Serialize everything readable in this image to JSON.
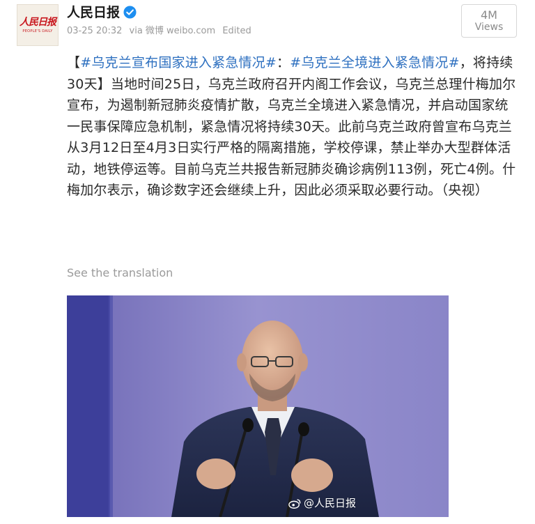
{
  "author": {
    "name": "人民日报",
    "avatar_logo": "人民日报",
    "avatar_logo_sub": "PEOPLE'S DAILY",
    "verified_icon": "verified-badge-icon"
  },
  "meta": {
    "timestamp": "03-25 20:32",
    "via": "via 微博 weibo.com",
    "edited": "Edited"
  },
  "views": {
    "count": "4M",
    "label": "Views"
  },
  "post": {
    "bracket_open": "【",
    "hashtag1": "#乌克兰宣布国家进入紧急情况#",
    "colon": "：",
    "hashtag2": "#乌克兰全境进入紧急情况#",
    "lead": "，将持续30天】",
    "body": "当地时间25日，乌克兰政府召开内阁工作会议，乌克兰总理什梅加尔宣布，为遏制新冠肺炎疫情扩散，乌克兰全境进入紧急情况，并启动国家统一民事保障应急机制，紧急情况将持续30天。此前乌克兰政府曾宣布乌克兰从3月12日至4月3日实行严格的隔离措施，学校停课，禁止举办大型群体活动，地铁停运等。目前乌克兰共报告新冠肺炎确诊病例113例，死亡4例。什梅加尔表示，确诊数字还会继续上升，因此必须采取必要行动。（央视）"
  },
  "translate_link": "See the translation",
  "image": {
    "watermark": "@人民日报",
    "watermark_icon": "weibo-logo-icon"
  },
  "colors": {
    "hashtag": "#2e70c0",
    "meta_gray": "#9a9a9a",
    "photo_background": "#8a86c6"
  }
}
